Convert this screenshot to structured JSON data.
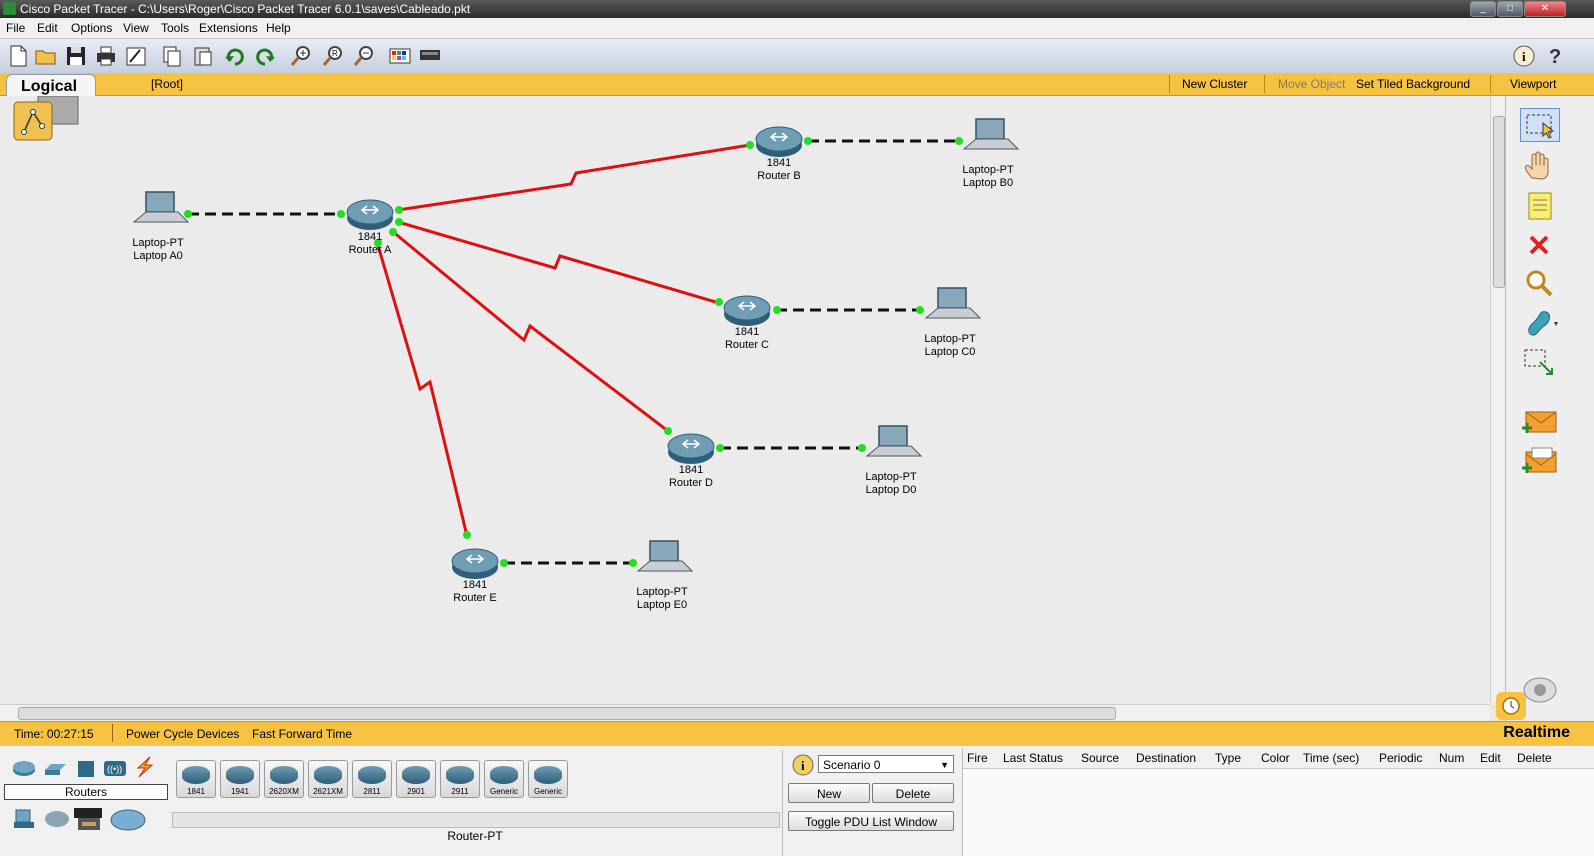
{
  "window": {
    "title": "Cisco Packet Tracer - C:\\Users\\Roger\\Cisco Packet Tracer 6.0.1\\saves\\Cableado.pkt"
  },
  "menu": [
    "File",
    "Edit",
    "Options",
    "View",
    "Tools",
    "Extensions",
    "Help"
  ],
  "toolbar": {
    "icons": [
      "new-file-icon",
      "open-folder-icon",
      "save-icon",
      "print-icon",
      "activity-wizard-icon",
      "copy-icon",
      "paste-icon",
      "undo-icon",
      "redo-icon",
      "zoom-in-icon",
      "zoom-reset-icon",
      "zoom-out-icon",
      "palette-icon",
      "custom-device-icon"
    ],
    "right_icons": [
      "info-icon",
      "help-icon"
    ]
  },
  "workspace_bar": {
    "tab": "Logical",
    "path": "[Root]",
    "new_cluster": "New Cluster",
    "move_object": "Move Object",
    "set_tiled_background": "Set Tiled Background",
    "viewport": "Viewport"
  },
  "devices": {
    "router_a": {
      "model": "1841",
      "name": "Router A"
    },
    "router_b": {
      "model": "1841",
      "name": "Router B"
    },
    "router_c": {
      "model": "1841",
      "name": "Router C"
    },
    "router_d": {
      "model": "1841",
      "name": "Router D"
    },
    "router_e": {
      "model": "1841",
      "name": "Router E"
    },
    "laptop_a0": {
      "model": "Laptop-PT",
      "name": "Laptop A0"
    },
    "laptop_b0": {
      "model": "Laptop-PT",
      "name": "Laptop B0"
    },
    "laptop_c0": {
      "model": "Laptop-PT",
      "name": "Laptop C0"
    },
    "laptop_d0": {
      "model": "Laptop-PT",
      "name": "Laptop D0"
    },
    "laptop_e0": {
      "model": "Laptop-PT",
      "name": "Laptop E0"
    }
  },
  "links": [
    {
      "from": "Router A",
      "to": "Router B",
      "type": "serial"
    },
    {
      "from": "Router A",
      "to": "Router C",
      "type": "serial"
    },
    {
      "from": "Router A",
      "to": "Router D",
      "type": "serial"
    },
    {
      "from": "Router A",
      "to": "Router E",
      "type": "serial"
    },
    {
      "from": "Router A",
      "to": "Laptop A0",
      "type": "copper-crossover"
    },
    {
      "from": "Router B",
      "to": "Laptop B0",
      "type": "copper-crossover"
    },
    {
      "from": "Router C",
      "to": "Laptop C0",
      "type": "copper-crossover"
    },
    {
      "from": "Router D",
      "to": "Laptop D0",
      "type": "copper-crossover"
    },
    {
      "from": "Router E",
      "to": "Laptop E0",
      "type": "copper-crossover"
    }
  ],
  "right_palette": [
    "select-icon",
    "move-hand-icon",
    "note-icon",
    "delete-icon",
    "inspect-icon",
    "draw-shape-icon",
    "resize-icon",
    "add-simple-pdu-icon",
    "add-complex-pdu-icon"
  ],
  "status": {
    "time": "Time: 00:27:15",
    "power_cycle": "Power Cycle Devices",
    "fast_forward": "Fast Forward Time",
    "mode": "Realtime"
  },
  "device_panel": {
    "category": "Routers",
    "type_label": "Router-PT",
    "models": [
      "1841",
      "1941",
      "2620XM",
      "2621XM",
      "2811",
      "2901",
      "2911",
      "Generic",
      "Generic"
    ]
  },
  "scenario": {
    "selected": "Scenario 0",
    "new": "New",
    "delete": "Delete",
    "toggle": "Toggle PDU List Window"
  },
  "pdu_columns": [
    "Fire",
    "Last Status",
    "Source",
    "Destination",
    "Type",
    "Color",
    "Time (sec)",
    "Periodic",
    "Num",
    "Edit",
    "Delete"
  ],
  "colors": {
    "serial_link": "#dd1111",
    "link_up": "#22dd22",
    "status_bar": "#f5c242"
  }
}
